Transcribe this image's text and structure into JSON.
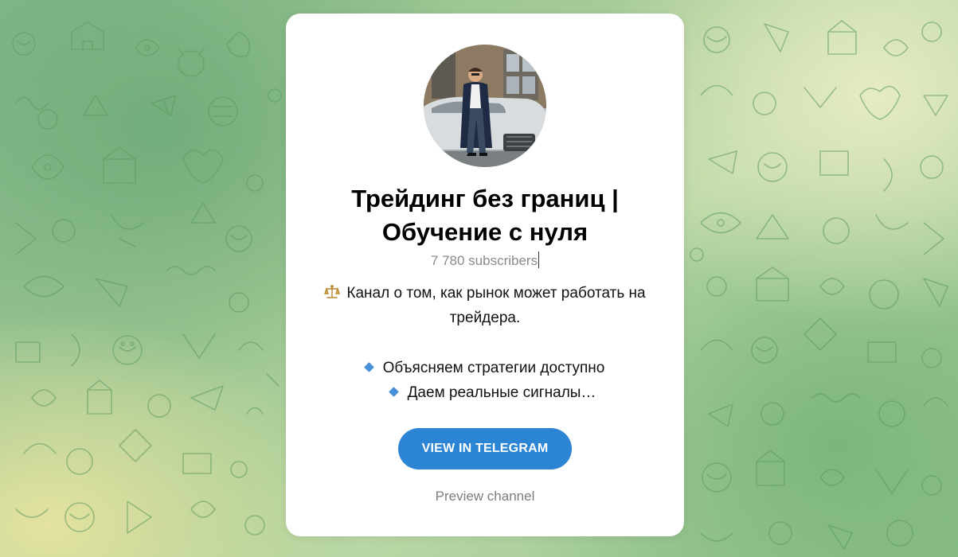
{
  "channel": {
    "title_line1": "Трейдинг без границ |",
    "title_line2": "Обучение с нуля",
    "subscribers": "7 780 subscribers",
    "avatar_icon": "channel-avatar-photo"
  },
  "description": {
    "line1": "Канал о том, как рынок может работать на",
    "line2": "трейдера.",
    "bullet1": "Объясняем стратегии доступно",
    "bullet2": "Даем реальные сигналы…",
    "line1_icon": "balance-scale-icon",
    "bullet_icon": "blue-diamond-icon"
  },
  "actions": {
    "view_label": "VIEW IN TELEGRAM",
    "preview_label": "Preview channel"
  },
  "colors": {
    "accent": "#2b85d4",
    "bullet": "#4a90d9",
    "background_green": "#8fc08c",
    "background_yellow": "#e8e4a0"
  }
}
